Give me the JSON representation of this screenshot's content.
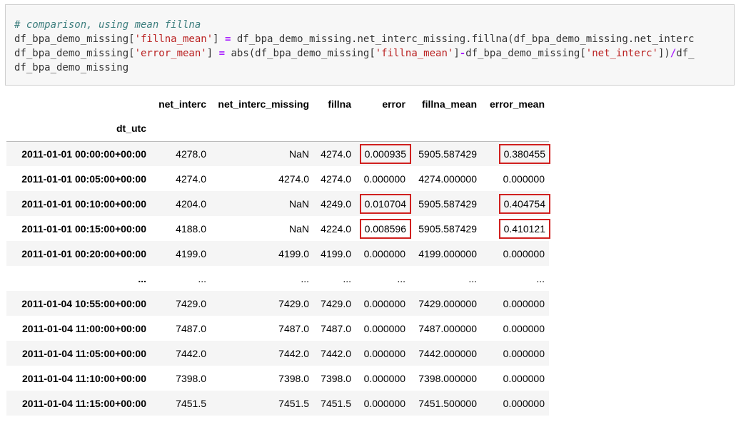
{
  "code": {
    "line1": "# comparison, using mean fillna",
    "line2": {
      "a": "df_bpa_demo_missing[",
      "s1": "'fillna_mean'",
      "b": "] ",
      "eq": "=",
      "c": " df_bpa_demo_missing.net_interc_missing.fillna(df_bpa_demo_missing.net_interc"
    },
    "line3": {
      "a": "df_bpa_demo_missing[",
      "s1": "'error_mean'",
      "b": "] ",
      "eq": "=",
      "c": " abs(df_bpa_demo_missing[",
      "s2": "'fillna_mean'",
      "d": "]",
      "minus": "-",
      "e": "df_bpa_demo_missing[",
      "s3": "'net_interc'",
      "f": "])",
      "div": "/",
      "g": "df_"
    },
    "line4": "df_bpa_demo_missing"
  },
  "table": {
    "columns": [
      "net_interc",
      "net_interc_missing",
      "fillna",
      "error",
      "fillna_mean",
      "error_mean"
    ],
    "index_name": "dt_utc",
    "rows": [
      {
        "idx": "2011-01-01 00:00:00+00:00",
        "cells": [
          "4278.0",
          "NaN",
          "4274.0",
          "0.000935",
          "5905.587429",
          "0.380455"
        ]
      },
      {
        "idx": "2011-01-01 00:05:00+00:00",
        "cells": [
          "4274.0",
          "4274.0",
          "4274.0",
          "0.000000",
          "4274.000000",
          "0.000000"
        ]
      },
      {
        "idx": "2011-01-01 00:10:00+00:00",
        "cells": [
          "4204.0",
          "NaN",
          "4249.0",
          "0.010704",
          "5905.587429",
          "0.404754"
        ]
      },
      {
        "idx": "2011-01-01 00:15:00+00:00",
        "cells": [
          "4188.0",
          "NaN",
          "4224.0",
          "0.008596",
          "5905.587429",
          "0.410121"
        ]
      },
      {
        "idx": "2011-01-01 00:20:00+00:00",
        "cells": [
          "4199.0",
          "4199.0",
          "4199.0",
          "0.000000",
          "4199.000000",
          "0.000000"
        ]
      },
      {
        "idx": "...",
        "cells": [
          "...",
          "...",
          "...",
          "...",
          "...",
          "..."
        ]
      },
      {
        "idx": "2011-01-04 10:55:00+00:00",
        "cells": [
          "7429.0",
          "7429.0",
          "7429.0",
          "0.000000",
          "7429.000000",
          "0.000000"
        ]
      },
      {
        "idx": "2011-01-04 11:00:00+00:00",
        "cells": [
          "7487.0",
          "7487.0",
          "7487.0",
          "0.000000",
          "7487.000000",
          "0.000000"
        ]
      },
      {
        "idx": "2011-01-04 11:05:00+00:00",
        "cells": [
          "7442.0",
          "7442.0",
          "7442.0",
          "0.000000",
          "7442.000000",
          "0.000000"
        ]
      },
      {
        "idx": "2011-01-04 11:10:00+00:00",
        "cells": [
          "7398.0",
          "7398.0",
          "7398.0",
          "0.000000",
          "7398.000000",
          "0.000000"
        ]
      },
      {
        "idx": "2011-01-04 11:15:00+00:00",
        "cells": [
          "7451.5",
          "7451.5",
          "7451.5",
          "0.000000",
          "7451.500000",
          "0.000000"
        ]
      }
    ]
  },
  "colors": {
    "highlight_box": "#d0201f",
    "comment": "#408080",
    "string": "#ba2121",
    "operator": "#aa22ff"
  }
}
